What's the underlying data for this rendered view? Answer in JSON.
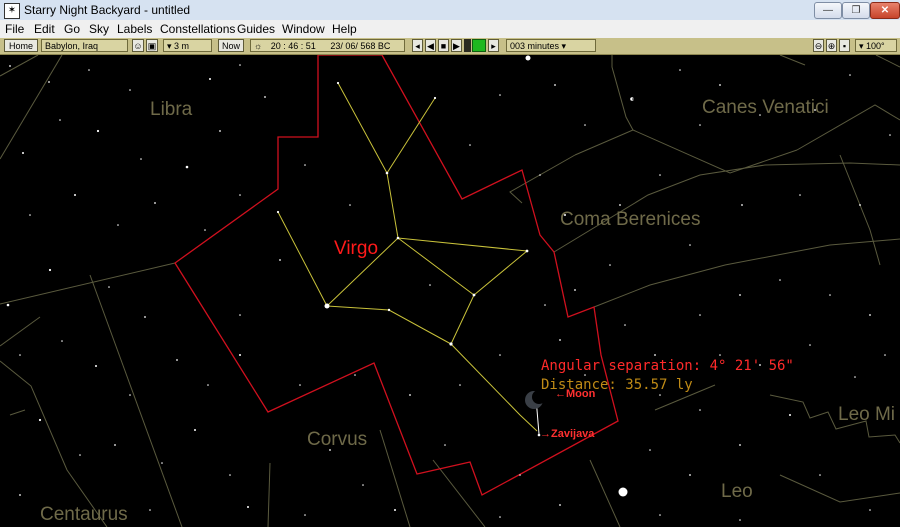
{
  "window": {
    "title": "Starry Night Backyard - untitled",
    "icon": "telescope-icon"
  },
  "menu": [
    "File",
    "Edit",
    "Go",
    "Sky",
    "Labels",
    "Constellations",
    "Guides",
    "Window",
    "Help"
  ],
  "toolbar": {
    "home_label": "Home",
    "location": "Babylon, Iraq",
    "elevation": "▾ 3 m",
    "now_label": "Now",
    "time": "20 : 46 : 51",
    "date": "23/ 06/  568 BC",
    "time_step": "003 minutes ▾",
    "fov": "▾ 100°"
  },
  "sky": {
    "constellations": [
      "Libra",
      "Canes Venatici",
      "Coma Berenices",
      "Virgo",
      "Corvus",
      "Leo Mi",
      "Leo",
      "Centaurus"
    ],
    "measure": {
      "angular_separation": "Angular separation: 4° 21' 56\"",
      "distance": "Distance: 35.57 ly"
    },
    "objects": [
      "Moon",
      "Zavijava"
    ]
  },
  "colors": {
    "virgo_boundary": "#d0101e",
    "constellation_lines": "#c9c23a",
    "label_dim": "#6f6a49",
    "accent_red": "#ff1a1a"
  }
}
